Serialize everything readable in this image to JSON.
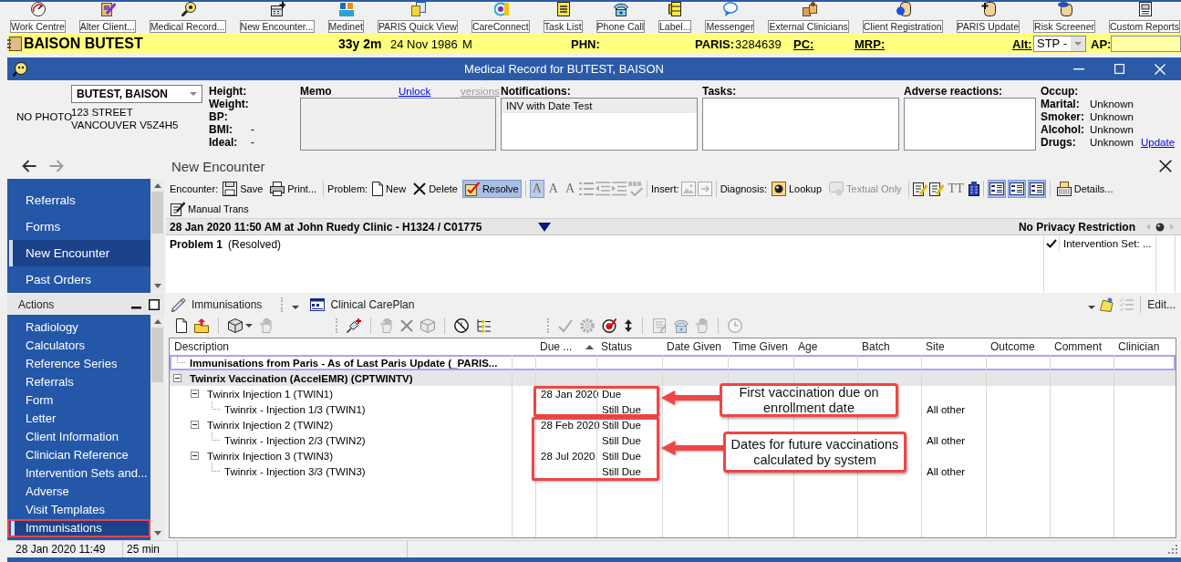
{
  "top_toolbar": [
    {
      "label": "Work Centre"
    },
    {
      "label": "Alter Client..."
    },
    {
      "label": "Medical Record..."
    },
    {
      "label": "New Encounter..."
    },
    {
      "label": "Medinet"
    },
    {
      "label": "PARIS Quick View"
    },
    {
      "label": "CareConnect"
    },
    {
      "label": "Task List"
    },
    {
      "label": "Phone Call"
    },
    {
      "label": "Label..."
    },
    {
      "label": "Messenger"
    },
    {
      "label": "External Clinicians"
    },
    {
      "label": "Client Registration"
    },
    {
      "label": "PARIS Update"
    },
    {
      "label": "Risk Screener"
    },
    {
      "label": "Custom Reports"
    }
  ],
  "patient_bar": {
    "name": "BAISON BUTEST",
    "age": "33y 2m",
    "birth_date": "24 Nov 1986",
    "sex": "M",
    "phn_label": "PHN:",
    "paris_label": "PARIS:",
    "paris_number": "3284639",
    "pc_label": "PC:",
    "mrp_label": "MRP:",
    "alt_label": "Alt:",
    "alt_value": "STP -",
    "ap_label": "AP:"
  },
  "window": {
    "title": "Medical Record for BUTEST, BAISON"
  },
  "client": {
    "photo": "NO PHOTO",
    "name": "BUTEST, BAISON",
    "address": [
      "123 STREET",
      "VANCOUVER V5Z4H5"
    ],
    "vitals": [
      {
        "label": "Height:"
      },
      {
        "label": "Weight:"
      },
      {
        "label": "BP:"
      },
      {
        "label": "BMI:",
        "reading": "-"
      },
      {
        "label": "Ideal:",
        "reading": "-"
      }
    ]
  },
  "memo": {
    "label": "Memo",
    "unlock": "Unlock",
    "versions": "versions",
    "locked": true
  },
  "notifications": {
    "label": "Notifications:",
    "items": [
      {
        "text": "INV with Date Test",
        "selected": true
      }
    ]
  },
  "tasks": {
    "label": "Tasks:"
  },
  "adverse_reactions": {
    "label": "Adverse reactions:"
  },
  "social_history": {
    "items": [
      {
        "label": "Occup:"
      },
      {
        "label": "Marital:",
        "value": "Unknown"
      },
      {
        "label": "Smoker:",
        "value": "Unknown"
      },
      {
        "label": "Alcohol:",
        "value": "Unknown"
      },
      {
        "label": "Drugs:",
        "value": "Unknown"
      }
    ],
    "update": "Update"
  },
  "navigation": {
    "title": "New Encounter",
    "back": {
      "disabled": false
    },
    "forward": {
      "disabled": true
    }
  },
  "sidebar": {
    "items": [
      {
        "label": "Referrals",
        "selected": false
      },
      {
        "label": "Forms",
        "selected": false
      },
      {
        "label": "New Encounter",
        "selected": true
      },
      {
        "label": "Past Orders",
        "selected": false
      }
    ]
  },
  "encounter": {
    "toolbar": [
      [
        {
          "kind": "label",
          "text": "Encounter:"
        },
        {
          "kind": "button",
          "label": "Save",
          "selected": false,
          "disabled": false
        },
        {
          "kind": "button",
          "label": "Print...",
          "selected": false,
          "disabled": false
        }
      ],
      [
        {
          "kind": "label",
          "text": "Problem:"
        },
        {
          "kind": "button",
          "label": "New",
          "selected": false,
          "disabled": false
        },
        {
          "kind": "button",
          "label": "Delete",
          "selected": false,
          "disabled": false
        },
        {
          "kind": "button",
          "label": "Resolve",
          "selected": true,
          "disabled": false
        }
      ],
      [
        {
          "kind": "glyph",
          "text": "A",
          "selected": true,
          "disabled": true
        },
        {
          "kind": "glyph",
          "text": "A",
          "selected": false,
          "disabled": true
        },
        {
          "kind": "glyph",
          "text": "A",
          "selected": false,
          "disabled": true
        },
        {
          "kind": "icon",
          "selected": false,
          "disabled": true
        },
        {
          "kind": "icon",
          "selected": false,
          "disabled": true
        },
        {
          "kind": "icon",
          "selected": false,
          "disabled": true
        },
        {
          "kind": "icon",
          "selected": false,
          "disabled": true
        }
      ],
      [
        {
          "kind": "label",
          "text": "Insert:"
        },
        {
          "kind": "icon",
          "selected": false,
          "disabled": true
        },
        {
          "kind": "icon",
          "selected": false,
          "disabled": true
        }
      ],
      [
        {
          "kind": "label",
          "text": "Diagnosis:"
        },
        {
          "kind": "button",
          "label": "Lookup",
          "selected": false,
          "disabled": false
        },
        {
          "kind": "button",
          "label": "Textual Only",
          "selected": false,
          "disabled": true
        }
      ],
      [
        {
          "kind": "icon",
          "selected": false,
          "disabled": false
        },
        {
          "kind": "icon",
          "selected": false,
          "disabled": false
        },
        {
          "kind": "glyph",
          "text": "TT",
          "selected": false,
          "disabled": true
        },
        {
          "kind": "icon",
          "selected": false,
          "disabled": false
        }
      ],
      [
        {
          "kind": "icon",
          "selected": true,
          "disabled": false
        },
        {
          "kind": "icon",
          "selected": true,
          "disabled": false
        },
        {
          "kind": "icon",
          "selected": true,
          "disabled": false
        }
      ],
      [
        {
          "kind": "button",
          "label": "Details...",
          "selected": false,
          "disabled": false
        }
      ]
    ],
    "manual_trans": "Manual Trans",
    "visit": "28 Jan 2020 11:50 AM at John Ruedy Clinic - H1324 / C01775",
    "privacy": "No Privacy Restriction",
    "problem": {
      "title": "Problem 1",
      "status": "(Resolved)"
    },
    "side_items": [
      {
        "text": "Intervention Set: ...",
        "checked": true
      }
    ]
  },
  "actions": {
    "title": "Actions",
    "items": [
      {
        "label": "Radiology",
        "selected": false,
        "highlighted": false
      },
      {
        "label": "Calculators",
        "selected": false,
        "highlighted": false
      },
      {
        "label": "Reference Series",
        "selected": false,
        "highlighted": false
      },
      {
        "label": "Referrals",
        "selected": false,
        "highlighted": false
      },
      {
        "label": "Form",
        "selected": false,
        "highlighted": false
      },
      {
        "label": "Letter",
        "selected": false,
        "highlighted": false
      },
      {
        "label": "Client Information",
        "selected": false,
        "highlighted": false
      },
      {
        "label": "Clinician Reference",
        "selected": false,
        "highlighted": false
      },
      {
        "label": "Intervention Sets and...",
        "selected": false,
        "highlighted": false
      },
      {
        "label": "Adverse",
        "selected": false,
        "highlighted": false
      },
      {
        "label": "Visit Templates",
        "selected": false,
        "highlighted": false
      },
      {
        "label": "Immunisations",
        "selected": true,
        "highlighted": true
      }
    ]
  },
  "immunisations": {
    "views": [
      {
        "label": "Immunisations"
      },
      {
        "label": "Clinical CarePlan"
      }
    ],
    "toolbar": [
      [
        [
          {
            "disabled": false,
            "dropdown": false
          },
          {
            "disabled": false,
            "dropdown": false
          }
        ],
        [
          {
            "disabled": false,
            "dropdown": true
          },
          {
            "disabled": true,
            "dropdown": false
          }
        ]
      ],
      [
        [
          {
            "disabled": false,
            "dropdown": false
          }
        ],
        [
          {
            "disabled": true,
            "dropdown": false
          },
          {
            "disabled": true,
            "dropdown": false
          },
          {
            "disabled": true,
            "dropdown": false
          }
        ],
        [
          {
            "disabled": false,
            "dropdown": false
          },
          {
            "disabled": false,
            "dropdown": false
          }
        ]
      ],
      [
        [
          {
            "disabled": true,
            "dropdown": false
          },
          {
            "disabled": true,
            "dropdown": false
          },
          {
            "disabled": false,
            "dropdown": false
          },
          {
            "disabled": false,
            "dropdown": false
          }
        ],
        [
          {
            "disabled": true,
            "dropdown": false
          },
          {
            "disabled": true,
            "dropdown": false
          },
          {
            "disabled": true,
            "dropdown": false
          }
        ],
        [
          {
            "disabled": true,
            "dropdown": false
          }
        ]
      ]
    ],
    "right_tools": [
      {
        "disabled": false,
        "dropdown": true
      },
      {
        "disabled": true,
        "dropdown": false
      }
    ],
    "edit": "Edit...",
    "columns": [
      {
        "label": "Description",
        "sorted": false
      },
      {
        "label": "Due ...",
        "sorted": true
      },
      {
        "label": "Status",
        "sorted": false
      },
      {
        "label": "Date Given",
        "sorted": false
      },
      {
        "label": "Time Given",
        "sorted": false
      },
      {
        "label": "Age",
        "sorted": false
      },
      {
        "label": "Batch",
        "sorted": false
      },
      {
        "label": "Site",
        "sorted": false
      },
      {
        "label": "Outcome",
        "sorted": false
      },
      {
        "label": "Comment",
        "sorted": false
      },
      {
        "label": "Clinician",
        "sorted": false
      }
    ],
    "rows": [
      {
        "description": "Immunisations from Paris - As of Last Paris Update (_PARIS...",
        "kind": "group",
        "selected": true
      },
      {
        "description": "Twinrix Vaccination (AccelEMR) (CPTWINTV)",
        "kind": "group",
        "selected": false,
        "expanded": true,
        "children": [
          {
            "description": "Twinrix Injection 1 (TWIN1)",
            "kind": "item",
            "selected": false,
            "expanded": true,
            "due": "28 Jan 2020",
            "status": "Due",
            "children": [
              {
                "description": "Twinrix - Injection 1/3 (TWIN1)",
                "kind": "item",
                "selected": false,
                "status": "Still Due",
                "site": "All other"
              }
            ]
          },
          {
            "description": "Twinrix Injection 2 (TWIN2)",
            "kind": "item",
            "selected": false,
            "expanded": true,
            "due": "28 Feb 2020",
            "status": "Still Due",
            "children": [
              {
                "description": "Twinrix - Injection 2/3 (TWIN2)",
                "kind": "item",
                "selected": false,
                "status": "Still Due",
                "site": "All other"
              }
            ]
          },
          {
            "description": "Twinrix Injection 3 (TWIN3)",
            "kind": "item",
            "selected": false,
            "expanded": true,
            "due": "28 Jul 2020",
            "status": "Still Due",
            "children": [
              {
                "description": "Twinrix - Injection 3/3 (TWIN3)",
                "kind": "item",
                "selected": false,
                "status": "Still Due",
                "site": "All other"
              }
            ]
          }
        ]
      }
    ]
  },
  "status_bar": {
    "datetime": "28 Jan 2020 11:49",
    "duration": "25 min"
  },
  "annotations": [
    {
      "text": "First vaccination due on enrollment date"
    },
    {
      "text": "Dates for future vaccinations calculated by system"
    }
  ]
}
